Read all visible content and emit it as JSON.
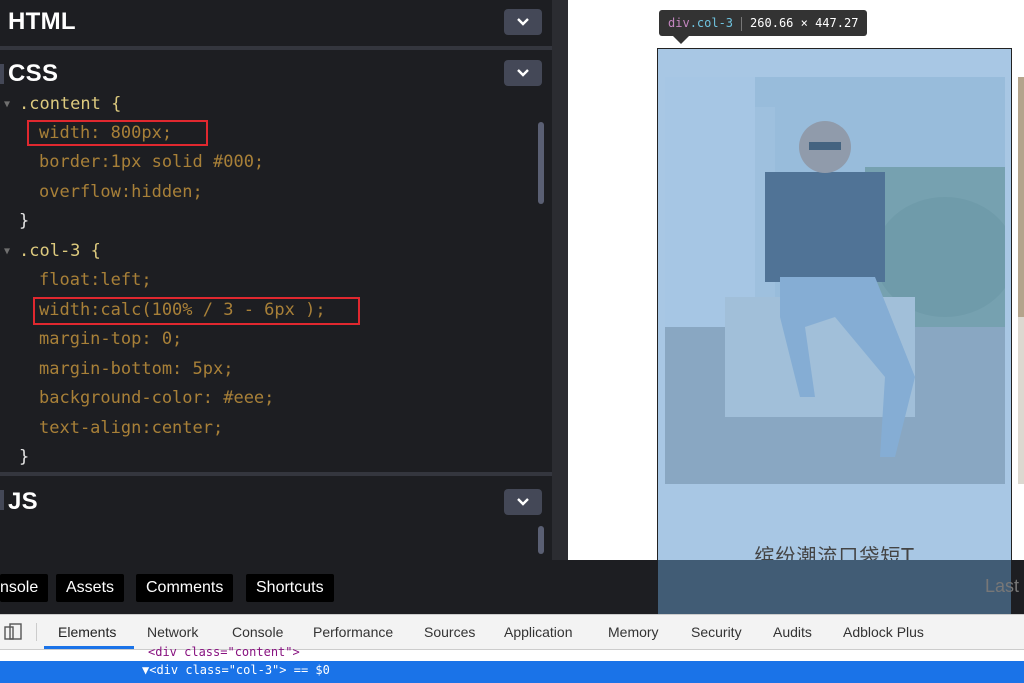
{
  "editor": {
    "html_title": "HTML",
    "css_title": "CSS",
    "js_title": "JS",
    "css_lines": [
      ".content {",
      "width: 800px;",
      "border:1px solid #000;",
      "overflow:hidden;",
      "}",
      ".col-3 {",
      "float:left;",
      "width:calc(100% / 3 - 6px );",
      "margin-top: 0;",
      "margin-bottom: 5px;",
      "background-color: #eee;",
      "text-align:center;",
      "}"
    ]
  },
  "preview": {
    "tooltip_tag": "div",
    "tooltip_class": ".col-3",
    "tooltip_size": "260.66 × 447.27",
    "card_title": "缤纷潮流口袋短T",
    "last_text": "Last"
  },
  "toolbar": {
    "buttons": [
      "nsole",
      "Assets",
      "Comments",
      "Shortcuts"
    ]
  },
  "devtools": {
    "tabs": [
      "Elements",
      "Network",
      "Console",
      "Performance",
      "Sources",
      "Application",
      "Memory",
      "Security",
      "Audits",
      "Adblock Plus"
    ],
    "dom_prev": "<div class=\"content\">",
    "dom_selected": "▼<div class=\"col-3\"> == $0"
  },
  "colors": {
    "editor_bg": "#1d1e22",
    "highlight_red": "#e0282f",
    "overlay_blue": "#6fa8dc",
    "devtools_accent": "#1a73e8"
  }
}
